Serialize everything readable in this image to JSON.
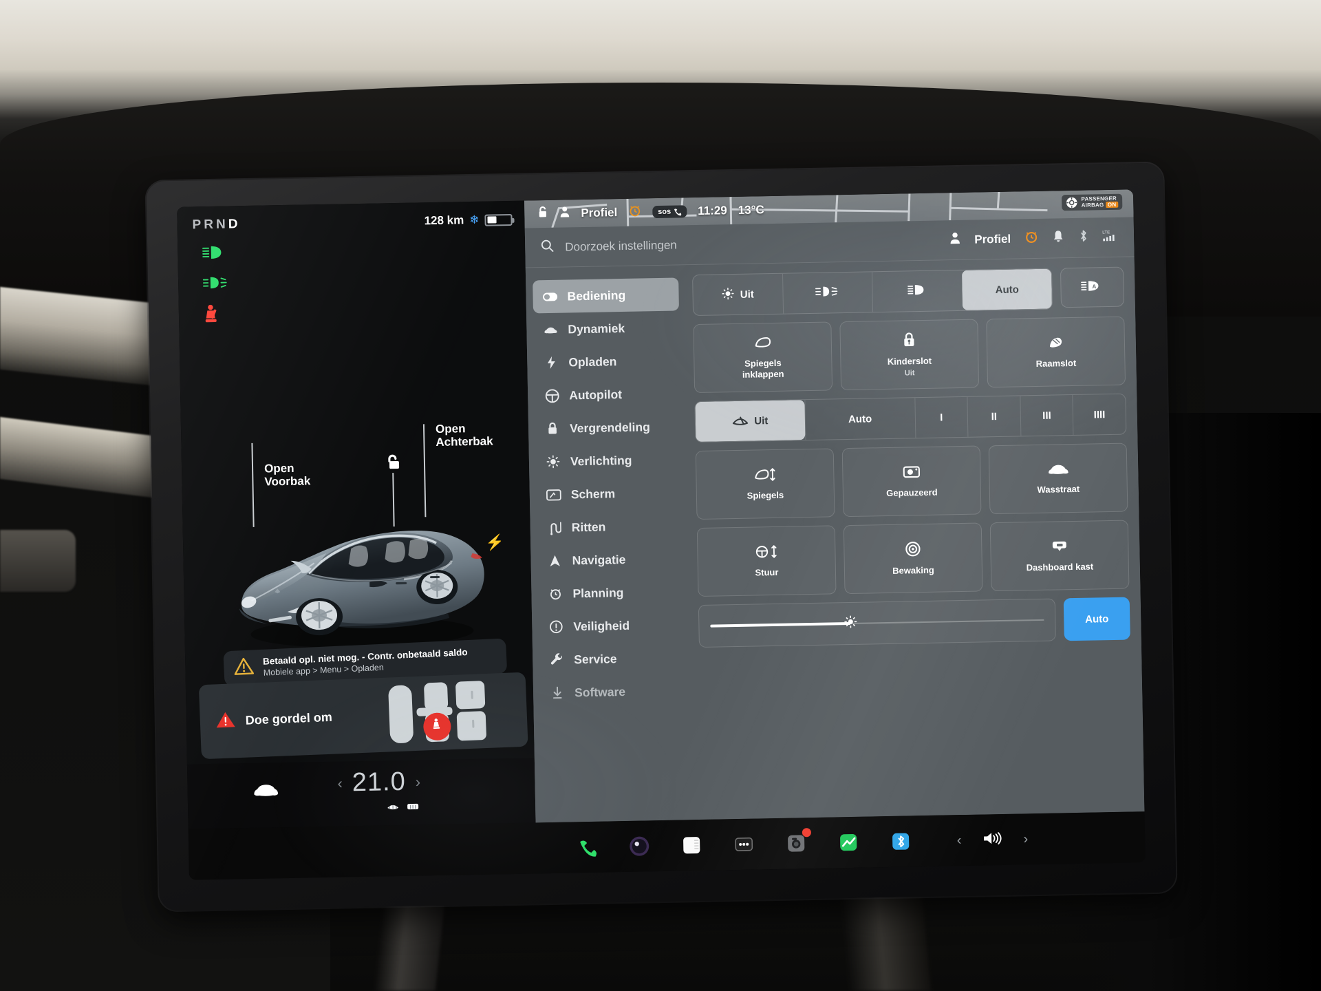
{
  "car_panel": {
    "gear_indicator": "PRND",
    "gear_active": "D",
    "range": "128 km",
    "snow_icon": "snowflake-icon",
    "battery_level_pct": 42,
    "telltales": [
      {
        "name": "low-beam-telltale",
        "color": "#2bdd6a"
      },
      {
        "name": "front-fog-telltale",
        "color": "#2bdd6a"
      },
      {
        "name": "seatbelt-telltale",
        "color": "#ff4136"
      }
    ],
    "callouts": {
      "front_trunk": "Open\nVoorbak",
      "front_trunk_l1": "Open",
      "front_trunk_l2": "Voorbak",
      "rear_trunk_l1": "Open",
      "rear_trunk_l2": "Achterbak",
      "unlock_icon": "unlock-icon",
      "charge_icon": "charge-bolt-icon"
    },
    "toast": {
      "icon": "warning-triangle-icon",
      "title": "Betaald opl. niet mog. - Contr. onbetaald saldo",
      "subtitle": "Mobiele app > Menu > Opladen"
    },
    "seatbelt_alert": {
      "icon": "red-warning-triangle-icon",
      "label": "Doe gordel om"
    },
    "climate": {
      "car_icon": "car-front-icon",
      "prev_icon": "chevron-left-icon",
      "temperature": "21.0",
      "next_icon": "chevron-right-icon",
      "defrost_rear": "rear-defrost-icon",
      "defrost_front": "front-defrost-icon"
    }
  },
  "map_bar": {
    "lock_icon": "lock-icon",
    "profile_icon": "person-icon",
    "profile_label": "Profiel",
    "alarm_icon": "alarm-clock-icon",
    "sos_label": "sos",
    "time": "11:29",
    "outside_temp": "13°C",
    "airbag_line1": "PASSENGER",
    "airbag_line2": "AIRBAG",
    "airbag_state": "ON"
  },
  "search": {
    "icon": "search-icon",
    "placeholder": "Doorzoek instellingen",
    "profile_icon": "person-icon",
    "profile_label": "Profiel",
    "alarm_icon": "alarm-clock-icon",
    "bell_icon": "bell-icon",
    "bluetooth_icon": "bluetooth-icon",
    "signal_icon": "lte-signal-icon",
    "signal_label": "LTE"
  },
  "sidebar": {
    "items": [
      {
        "label": "Bediening",
        "icon": "toggle-switch-icon",
        "active": true
      },
      {
        "label": "Dynamiek",
        "icon": "car-side-icon",
        "active": false
      },
      {
        "label": "Opladen",
        "icon": "bolt-icon",
        "active": false
      },
      {
        "label": "Autopilot",
        "icon": "steering-wheel-icon",
        "active": false
      },
      {
        "label": "Vergrendeling",
        "icon": "lock-icon",
        "active": false
      },
      {
        "label": "Verlichting",
        "icon": "sun-icon",
        "active": false
      },
      {
        "label": "Scherm",
        "icon": "display-icon",
        "active": false
      },
      {
        "label": "Ritten",
        "icon": "route-icon",
        "active": false
      },
      {
        "label": "Navigatie",
        "icon": "navigation-arrow-icon",
        "active": false
      },
      {
        "label": "Planning",
        "icon": "schedule-clock-icon",
        "active": false
      },
      {
        "label": "Veiligheid",
        "icon": "alert-circle-icon",
        "active": false
      },
      {
        "label": "Service",
        "icon": "wrench-icon",
        "active": false
      },
      {
        "label": "Software",
        "icon": "download-icon",
        "active": false
      }
    ]
  },
  "controls": {
    "lights": {
      "options": [
        {
          "label": "Uit",
          "icon": "headlight-off-icon",
          "selected": false
        },
        {
          "label": "",
          "icon": "parking-lights-icon",
          "selected": false
        },
        {
          "label": "",
          "icon": "low-beam-icon",
          "selected": false
        },
        {
          "label": "Auto",
          "icon": "",
          "selected": true
        }
      ],
      "auto_highbeam": {
        "icon": "auto-high-beam-icon",
        "label": ""
      }
    },
    "tiles_row1": [
      {
        "label": "Spiegels inklappen",
        "label_l1": "Spiegels",
        "label_l2": "inklappen",
        "sub": "",
        "icon": "mirror-fold-icon"
      },
      {
        "label": "Kinderslot",
        "label_l1": "Kinderslot",
        "label_l2": "",
        "sub": "Uit",
        "icon": "child-lock-icon"
      },
      {
        "label": "Raamslot",
        "label_l1": "Raamslot",
        "label_l2": "",
        "sub": "",
        "icon": "window-lock-icon"
      }
    ],
    "wipers": {
      "options": [
        {
          "label": "Uit",
          "icon": "wiper-icon",
          "selected": true
        },
        {
          "label": "Auto",
          "icon": "",
          "selected": false
        },
        {
          "label": "I",
          "icon": "",
          "selected": false
        },
        {
          "label": "II",
          "icon": "",
          "selected": false
        },
        {
          "label": "III",
          "icon": "",
          "selected": false
        },
        {
          "label": "IIII",
          "icon": "",
          "selected": false
        }
      ]
    },
    "tiles_row2": [
      {
        "label": "Spiegels",
        "sub": "",
        "icon": "mirror-adjust-icon"
      },
      {
        "label": "Gepauzeerd",
        "sub": "",
        "icon": "camera-pause-icon"
      },
      {
        "label": "Wasstraat",
        "sub": "",
        "icon": "car-wash-icon"
      }
    ],
    "tiles_row3": [
      {
        "label": "Stuur",
        "sub": "",
        "icon": "steering-adjust-icon"
      },
      {
        "label": "Bewaking",
        "sub": "",
        "icon": "sentry-mode-icon"
      },
      {
        "label": "Dashboard kast",
        "sub": "",
        "icon": "glovebox-icon"
      }
    ],
    "brightness": {
      "icon": "brightness-icon",
      "value_pct": 42,
      "auto_label": "Auto"
    }
  },
  "dock": {
    "apps": [
      {
        "name": "phone-app-icon",
        "badge": false
      },
      {
        "name": "camera-lens-icon",
        "badge": false
      },
      {
        "name": "notes-app-icon",
        "badge": false
      },
      {
        "name": "more-apps-icon",
        "badge": false
      },
      {
        "name": "dashcam-app-icon",
        "badge": true
      },
      {
        "name": "stocks-app-icon",
        "badge": false
      },
      {
        "name": "bluetooth-app-icon",
        "badge": false
      }
    ],
    "volume": {
      "prev_icon": "chevron-left-icon",
      "speaker_icon": "speaker-icon",
      "next_icon": "chevron-right-icon"
    }
  },
  "colors": {
    "accent_blue": "#3aa0f0",
    "warning_amber": "#e8b339",
    "alert_red": "#ff3b30",
    "telltale_green": "#2bdd6a",
    "panel_grey": "#565c60",
    "selected_grey": "#c9cdd0"
  }
}
